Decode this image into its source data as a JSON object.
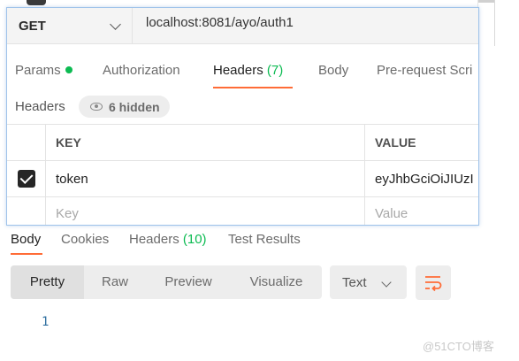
{
  "request": {
    "method": "GET",
    "url": "localhost:8081/ayo/auth1"
  },
  "request_tabs": [
    {
      "label": "Params",
      "dot": true
    },
    {
      "label": "Authorization"
    },
    {
      "label": "Headers",
      "count": "(7)",
      "active": true
    },
    {
      "label": "Body"
    },
    {
      "label": "Pre-request Scri"
    }
  ],
  "headers_section": {
    "title": "Headers",
    "hidden_label": "6 hidden"
  },
  "headers_table": {
    "columns": [
      "KEY",
      "VALUE"
    ],
    "rows": [
      {
        "checked": true,
        "key": "token",
        "value": "eyJhbGciOiJIUzI"
      }
    ],
    "placeholder": {
      "key": "Key",
      "value": "Value"
    }
  },
  "response_tabs": [
    {
      "label": "Body",
      "active": true
    },
    {
      "label": "Cookies"
    },
    {
      "label": "Headers",
      "count": "(10)"
    },
    {
      "label": "Test Results"
    }
  ],
  "view_modes": [
    "Pretty",
    "Raw",
    "Preview",
    "Visualize"
  ],
  "active_view_mode": "Pretty",
  "format": "Text",
  "editor": {
    "line_numbers": [
      "1"
    ]
  },
  "watermark": "@51CTO博客",
  "colors": {
    "accent": "#ff6c37",
    "success": "#0cbb52",
    "popup_border": "#9fc3ea"
  }
}
